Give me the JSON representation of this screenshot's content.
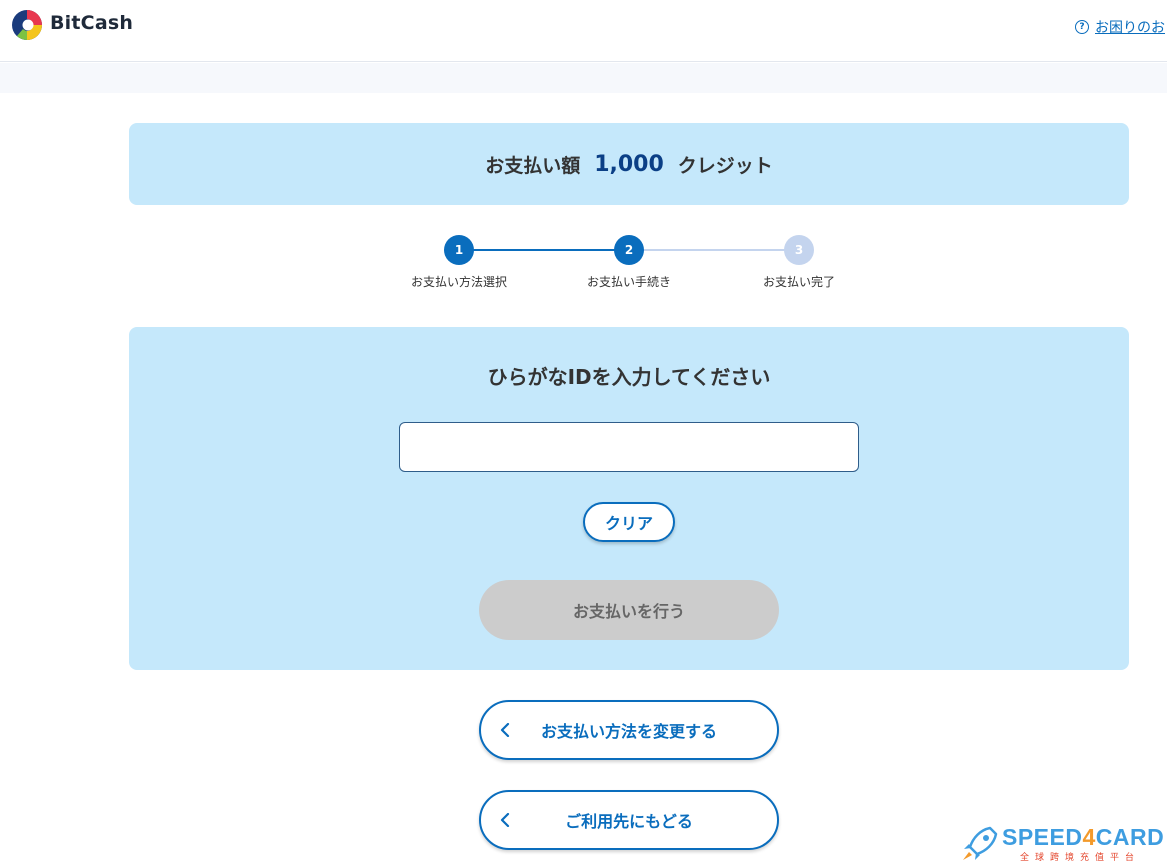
{
  "header": {
    "logo_text": "BitCash",
    "help_icon": "question-circle-icon",
    "help_link": "お困りのお"
  },
  "summary": {
    "amount_label": "お支払い額",
    "amount_value": "1,000",
    "amount_unit": "クレジット"
  },
  "steps": [
    {
      "number": "1",
      "label": "お支払い方法選択",
      "state": "done"
    },
    {
      "number": "2",
      "label": "お支払い手続き",
      "state": "current"
    },
    {
      "number": "3",
      "label": "お支払い完了",
      "state": "upcoming"
    }
  ],
  "form": {
    "title": "ひらがなIDを入力してください",
    "input_value": "",
    "clear_label": "クリア",
    "submit_label": "お支払いを行う"
  },
  "nav": {
    "change_method_label": "お支払い方法を変更する",
    "back_label": "ご利用先にもどる",
    "chevron_icon": "chevron-left-icon"
  },
  "watermark": {
    "brand_pre": "SPEED",
    "brand_digit": "4",
    "brand_post": "CARD",
    "tagline": "全球跨境充值平台"
  },
  "colors": {
    "accent": "#0a6dbd",
    "panel": "#c5e8fb",
    "step_active": "#0a6dbd",
    "step_inactive": "#c4d4ee",
    "disabled_button": "#cccccc",
    "amount_value": "#0b3f86"
  }
}
